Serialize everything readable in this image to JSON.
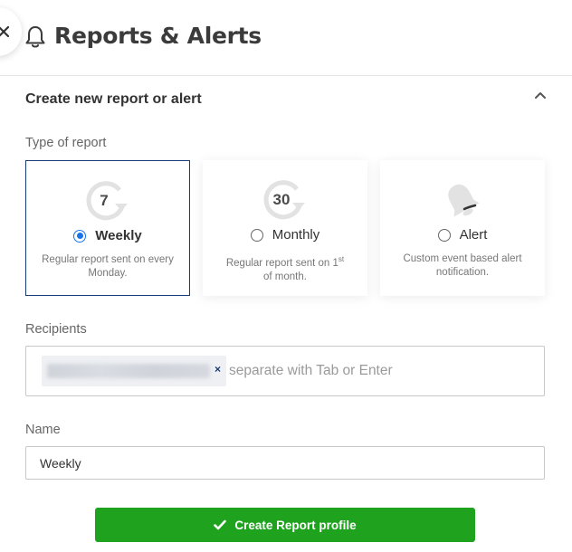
{
  "header": {
    "title": "Reports & Alerts",
    "bell_icon": "bell-icon",
    "close_icon": "close-icon"
  },
  "section": {
    "title": "Create new report or alert",
    "collapse_icon": "chevron-up-icon"
  },
  "report_type": {
    "label": "Type of report",
    "selected": "weekly",
    "options": [
      {
        "id": "weekly",
        "icon_text": "7",
        "label": "Weekly",
        "desc": "Regular report sent on every Monday."
      },
      {
        "id": "monthly",
        "icon_text": "30",
        "label": "Monthly",
        "desc_pre": "Regular report sent on 1",
        "desc_sup": "st",
        "desc_post": "of month."
      },
      {
        "id": "alert",
        "label": "Alert",
        "desc": "Custom event based alert notification."
      }
    ]
  },
  "recipients": {
    "label": "Recipients",
    "remove_label": "×",
    "placeholder": "separate with Tab or Enter"
  },
  "name": {
    "label": "Name",
    "value": "Weekly"
  },
  "create_button": {
    "label": "Create Report profile",
    "icon": "check-icon"
  },
  "colors": {
    "accent": "#1c3a78",
    "radio": "#1a73e8",
    "button": "#1fa31f"
  }
}
